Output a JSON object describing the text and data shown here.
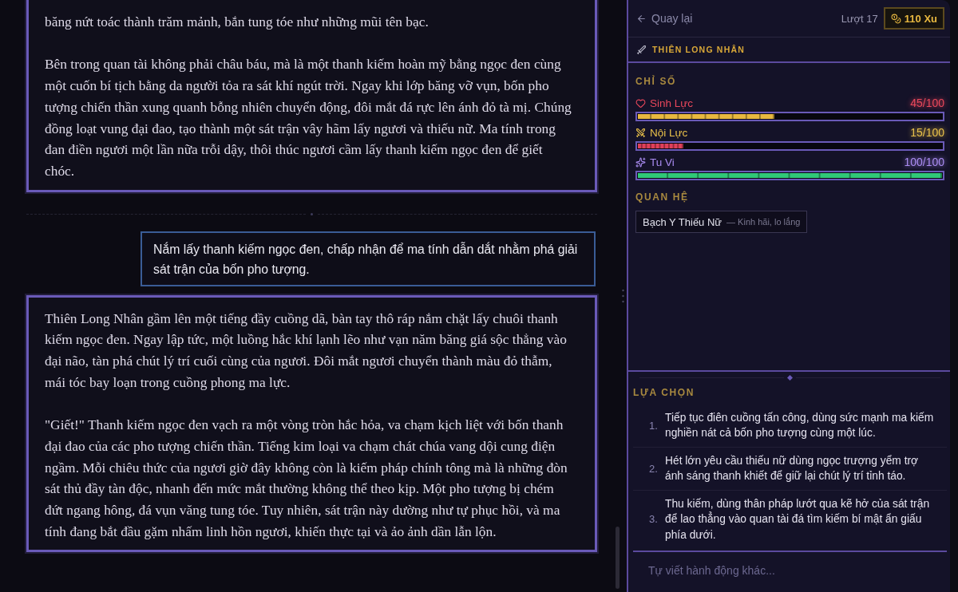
{
  "story": {
    "entries": [
      {
        "kind": "narration",
        "continued": true,
        "paragraphs": [
          "băng nứt toác thành trăm mảnh, bắn tung tóe như những mũi tên bạc.",
          "Bên trong quan tài không phải châu báu, mà là một thanh kiếm hoàn mỹ bằng ngọc đen cùng một cuốn bí tịch bằng da người tỏa ra sát khí ngút trời. Ngay khi lớp băng vỡ vụn, bốn pho tượng chiến thần xung quanh bỗng nhiên chuyển động, đôi mắt đá rực lên ánh đỏ tà mị. Chúng đồng loạt vung đại đao, tạo thành một sát trận vây hãm lấy ngươi và thiếu nữ. Ma tính trong đan điền ngươi một lần nữa trỗi dậy, thôi thúc ngươi cầm lấy thanh kiếm ngọc đen để giết chóc."
        ]
      },
      {
        "kind": "player_action",
        "text": "Nắm lấy thanh kiếm ngọc đen, chấp nhận để ma tính dẫn dắt nhằm phá giải sát trận của bốn pho tượng."
      },
      {
        "kind": "narration",
        "continued": false,
        "paragraphs": [
          "Thiên Long Nhân gầm lên một tiếng đầy cuồng dã, bàn tay thô ráp nắm chặt lấy chuôi thanh kiếm ngọc đen. Ngay lập tức, một luồng hắc khí lạnh lẽo như vạn năm băng giá sộc thẳng vào đại não, tàn phá chút lý trí cuối cùng của ngươi. Đôi mắt ngươi chuyển thành màu đỏ thẫm, mái tóc bay loạn trong cuồng phong ma lực.",
          "\"Giết!\" Thanh kiếm ngọc đen vạch ra một vòng tròn hắc hỏa, va chạm kịch liệt với bốn thanh đại đao của các pho tượng chiến thần. Tiếng kim loại va chạm chát chúa vang dội cung điện ngầm. Mỗi chiêu thức của ngươi giờ đây không còn là kiếm pháp chính tông mà là những đòn sát thủ đầy tàn độc, nhanh đến mức mắt thường không thể theo kịp. Một pho tượng bị chém đứt ngang hông, đá vụn văng tung tóe. Tuy nhiên, sát trận này dường như tự phục hồi, và ma tính đang bắt đầu gặm nhấm linh hồn ngươi, khiến thực tại và ảo ảnh dần lẫn lộn."
        ]
      }
    ]
  },
  "panel": {
    "back_label": "Quay lại",
    "turn": "Lượt 17",
    "coins": "110 Xu",
    "character": "THIÊN LONG NHÂN",
    "stats_heading": "CHỈ SỐ",
    "stats": [
      {
        "kind": "health",
        "label": "Sinh Lực",
        "value": "45/100",
        "level": 0.45,
        "color": "#e8475b"
      },
      {
        "kind": "energy",
        "label": "Nội Lực",
        "value": "15/100",
        "level": 0.15,
        "color": "#e8c04a"
      },
      {
        "kind": "cultivation",
        "label": "Tu Vi",
        "value": "100/100",
        "level": 1,
        "color": "#a98bf0"
      }
    ],
    "relations_heading": "QUAN HỆ",
    "relations": [
      {
        "name": "Bạch Y Thiếu Nữ",
        "mood": "— Kinh hãi, lo lắng"
      }
    ],
    "choices_heading": "LỰA CHỌN",
    "choices": [
      {
        "number": "1.",
        "text": "Tiếp tục điên cuồng tấn công, dùng sức mạnh ma kiếm nghiền nát cả bốn pho tượng cùng một lúc."
      },
      {
        "number": "2.",
        "text": "Hét lớn yêu cầu thiếu nữ dùng ngọc trượng yểm trợ ánh sáng thanh khiết để giữ lại chút lý trí tỉnh táo."
      },
      {
        "number": "3.",
        "text": "Thu kiếm, dùng thân pháp lướt qua kẽ hở của sát trận để lao thẳng vào quan tài đá tìm kiếm bí mật ẩn giấu phía dưới."
      }
    ],
    "input": {
      "placeholder": "Tự viết hành động khác..."
    }
  }
}
